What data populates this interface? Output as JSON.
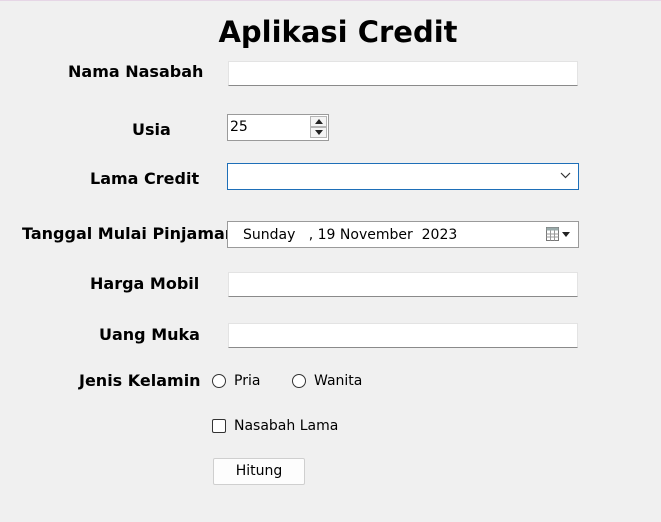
{
  "header": {
    "title": "Aplikasi Credit"
  },
  "form": {
    "nama_nasabah": {
      "label": "Nama Nasabah",
      "value": ""
    },
    "usia": {
      "label": "Usia",
      "value": "25"
    },
    "lama_credit": {
      "label": "Lama Credit",
      "value": ""
    },
    "tanggal_mulai": {
      "label": "Tanggal Mulai Pinjaman",
      "value": "Sunday   , 19 November  2023"
    },
    "harga_mobil": {
      "label": "Harga Mobil",
      "value": ""
    },
    "uang_muka": {
      "label": "Uang Muka",
      "value": ""
    },
    "jenis_kelamin": {
      "label": "Jenis Kelamin",
      "options": [
        "Pria",
        "Wanita"
      ],
      "selected": null
    },
    "nasabah_lama": {
      "label": "Nasabah Lama",
      "checked": false
    },
    "hitung_button": "Hitung"
  },
  "icons": {
    "spinner_up": "chevron-up-icon",
    "spinner_down": "chevron-down-icon",
    "combo_dropdown": "chevron-down-icon",
    "date_picker": "calendar-icon"
  }
}
